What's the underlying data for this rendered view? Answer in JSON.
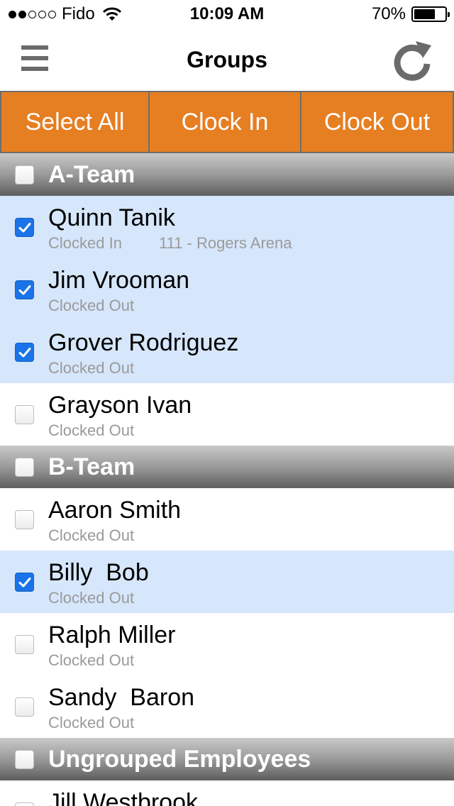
{
  "status_bar": {
    "carrier": "Fido",
    "time": "10:09 AM",
    "battery": "70%",
    "battery_level": 0.7,
    "signal_strength": 2
  },
  "nav": {
    "title": "Groups",
    "menu_icon": "hamburger-menu-icon",
    "refresh_icon": "refresh-icon"
  },
  "actions": {
    "select_all": "Select All",
    "clock_in": "Clock In",
    "clock_out": "Clock Out"
  },
  "colors": {
    "accent_orange": "#e67e22",
    "selected_row": "#d6e6fb",
    "checkbox_blue": "#1a73e8"
  },
  "groups": [
    {
      "name": "A-Team",
      "checked": false,
      "employees": [
        {
          "name": "Quinn Tanik",
          "status": "Clocked In",
          "location": "111 - Rogers Arena",
          "checked": true
        },
        {
          "name": "Jim Vrooman",
          "status": "Clocked Out",
          "location": "",
          "checked": true
        },
        {
          "name": "Grover Rodriguez",
          "status": "Clocked Out",
          "location": "",
          "checked": true
        },
        {
          "name": "Grayson Ivan",
          "status": "Clocked Out",
          "location": "",
          "checked": false
        }
      ]
    },
    {
      "name": "B-Team",
      "checked": false,
      "employees": [
        {
          "name": "Aaron Smith",
          "status": "Clocked Out",
          "location": "",
          "checked": false
        },
        {
          "name": "Billy  Bob",
          "status": "Clocked Out",
          "location": "",
          "checked": true
        },
        {
          "name": "Ralph Miller",
          "status": "Clocked Out",
          "location": "",
          "checked": false
        },
        {
          "name": "Sandy  Baron",
          "status": "Clocked Out",
          "location": "",
          "checked": false
        }
      ]
    },
    {
      "name": "Ungrouped Employees",
      "checked": false,
      "employees": [
        {
          "name": "Jill Westbrook",
          "status": "",
          "location": "",
          "checked": false
        }
      ]
    }
  ]
}
